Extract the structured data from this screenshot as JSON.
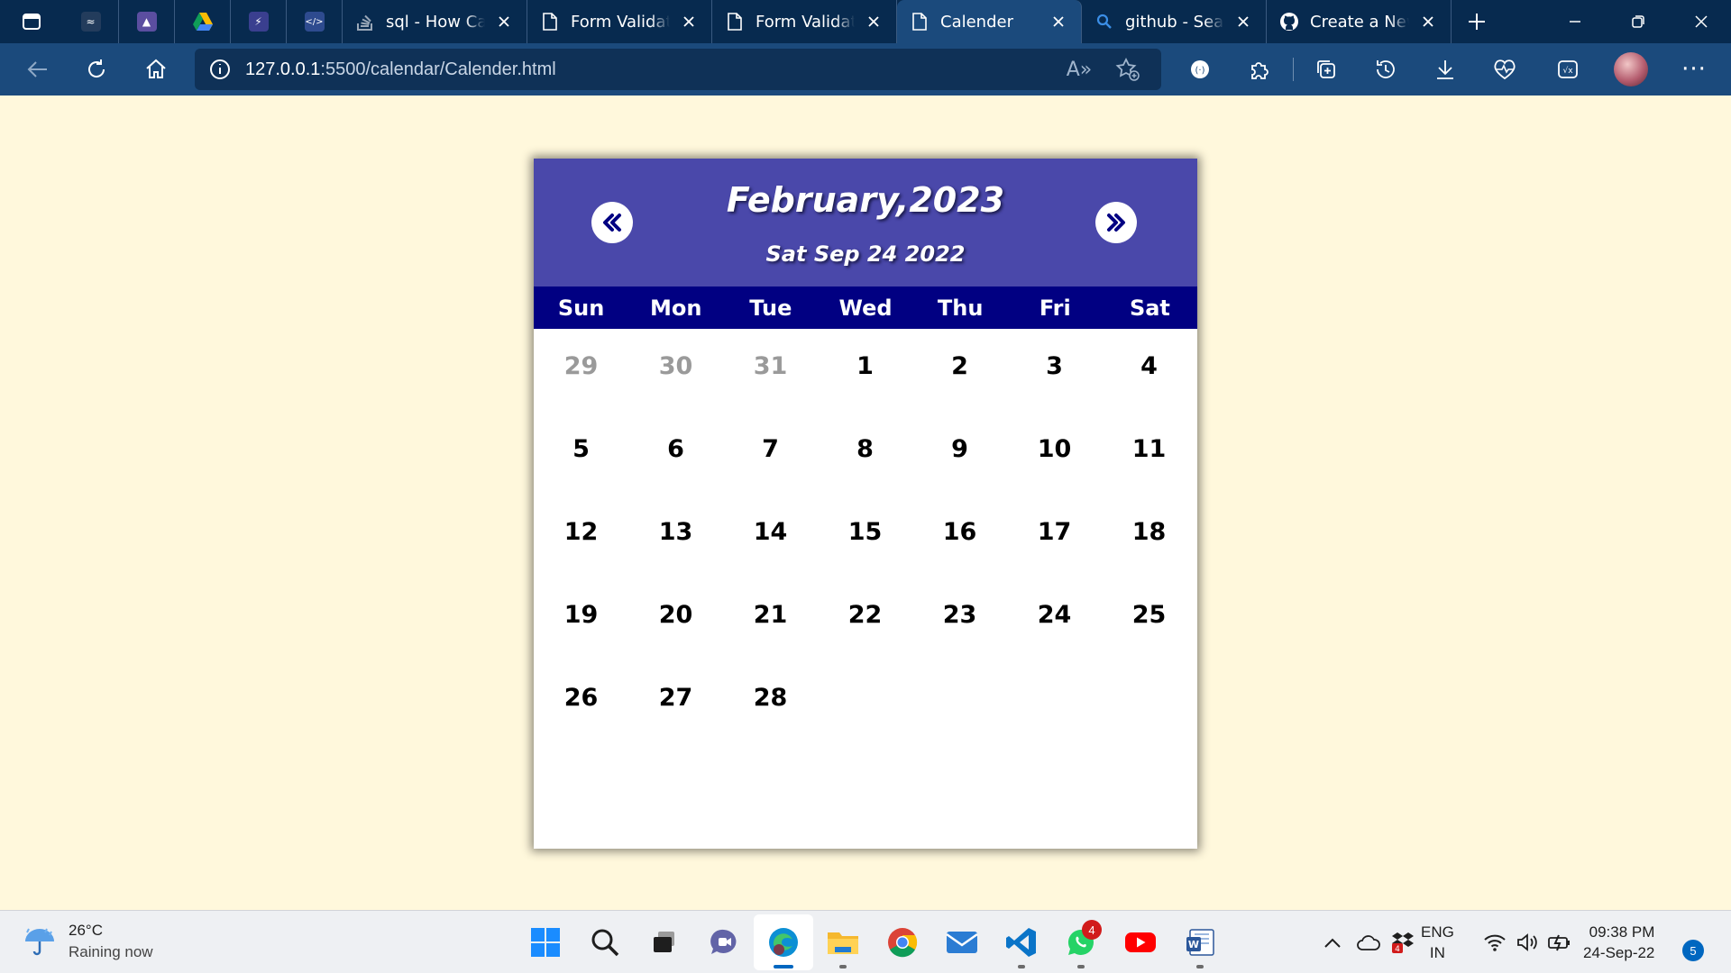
{
  "browser": {
    "tabs": [
      {
        "title": "sql - How Car",
        "icon": "stackoverflow-icon"
      },
      {
        "title": "Form Validatic",
        "icon": "page-icon"
      },
      {
        "title": "Form Validatic",
        "icon": "page-icon"
      },
      {
        "title": "Calender",
        "icon": "page-icon",
        "active": true
      },
      {
        "title": "github - Sear",
        "icon": "search-icon"
      },
      {
        "title": "Create a New",
        "icon": "github-icon"
      }
    ],
    "address": {
      "host": "127.0.0.1",
      "path": ":5500/calendar/Calender.html"
    }
  },
  "calendar": {
    "month_title": "February,2023",
    "today_text": "Sat Sep 24 2022",
    "weekdays": [
      "Sun",
      "Mon",
      "Tue",
      "Wed",
      "Thu",
      "Fri",
      "Sat"
    ],
    "days": [
      {
        "n": "29",
        "muted": true
      },
      {
        "n": "30",
        "muted": true
      },
      {
        "n": "31",
        "muted": true
      },
      {
        "n": "1"
      },
      {
        "n": "2"
      },
      {
        "n": "3"
      },
      {
        "n": "4"
      },
      {
        "n": "5"
      },
      {
        "n": "6"
      },
      {
        "n": "7"
      },
      {
        "n": "8"
      },
      {
        "n": "9"
      },
      {
        "n": "10"
      },
      {
        "n": "11"
      },
      {
        "n": "12"
      },
      {
        "n": "13"
      },
      {
        "n": "14"
      },
      {
        "n": "15"
      },
      {
        "n": "16"
      },
      {
        "n": "17"
      },
      {
        "n": "18"
      },
      {
        "n": "19"
      },
      {
        "n": "20"
      },
      {
        "n": "21"
      },
      {
        "n": "22"
      },
      {
        "n": "23"
      },
      {
        "n": "24"
      },
      {
        "n": "25"
      },
      {
        "n": "26"
      },
      {
        "n": "27"
      },
      {
        "n": "28"
      }
    ],
    "colors": {
      "header": "#4a48aa",
      "weekday_bar": "#010082",
      "page_background": "#fff8dc",
      "muted_day": "#9a9a9a"
    }
  },
  "taskbar": {
    "weather": {
      "temp": "26°C",
      "condition": "Raining now"
    },
    "whatsapp_badge": "4",
    "language": {
      "line1": "ENG",
      "line2": "IN"
    },
    "clock": {
      "time": "09:38 PM",
      "date": "24-Sep-22"
    },
    "notification_count": "5"
  }
}
